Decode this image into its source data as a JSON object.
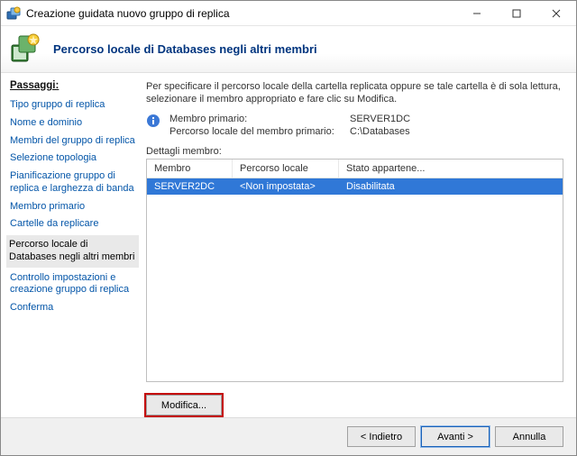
{
  "window": {
    "title": "Creazione guidata nuovo gruppo di replica"
  },
  "banner": {
    "title": "Percorso locale di Databases negli altri membri"
  },
  "steps": {
    "header": "Passaggi:",
    "items": [
      "Tipo gruppo di replica",
      "Nome e dominio",
      "Membri del gruppo di replica",
      "Selezione topologia",
      "Pianificazione gruppo di replica e larghezza di banda",
      "Membro primario",
      "Cartelle da replicare",
      "Percorso locale di Databases negli altri membri",
      "Controllo impostazioni e creazione gruppo di replica",
      "Conferma"
    ],
    "current_index": 7
  },
  "main": {
    "instruction": "Per specificare il percorso locale della cartella replicata oppure se tale cartella è di sola lettura, selezionare il membro appropriato e fare clic su Modifica.",
    "primary_member_label": "Membro primario:",
    "primary_member_value": "SERVER1DC",
    "primary_path_label": "Percorso locale del membro primario:",
    "primary_path_value": "C:\\Databases",
    "details_label": "Dettagli membro:",
    "columns": [
      "Membro",
      "Percorso locale",
      "Stato appartene..."
    ],
    "rows": [
      {
        "member": "SERVER2DC",
        "path": "<Non impostata>",
        "status": "Disabilitata"
      }
    ],
    "modify_label": "Modifica..."
  },
  "footer": {
    "back": "< Indietro",
    "next": "Avanti >",
    "cancel": "Annulla"
  }
}
